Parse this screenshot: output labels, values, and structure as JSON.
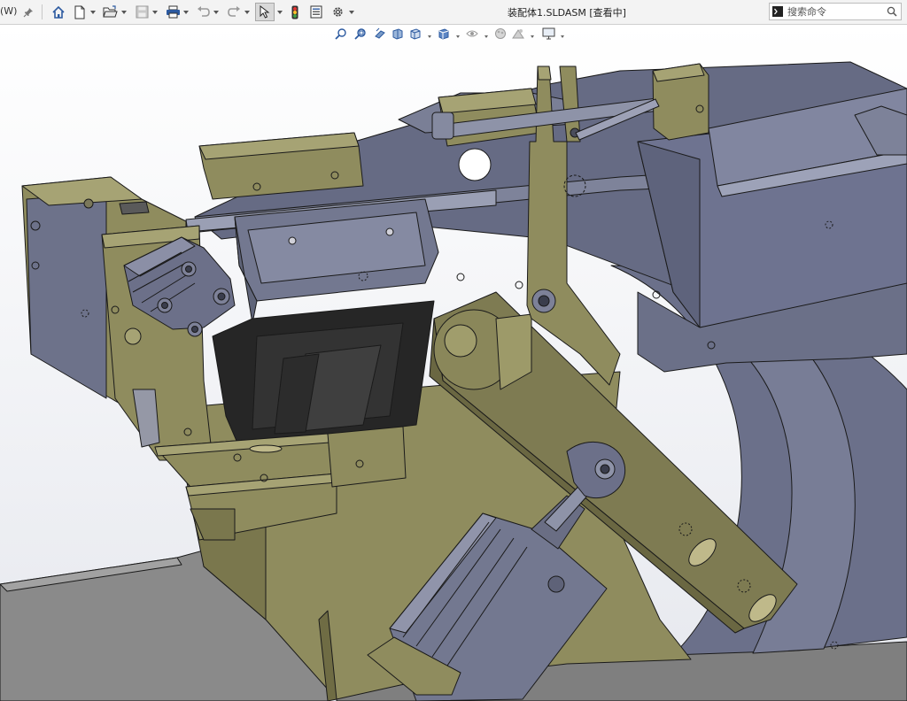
{
  "app": {
    "window_label_fragment": "(W)",
    "document_title": "装配体1.SLDASM [查看中]"
  },
  "toolbar": {
    "items": [
      {
        "name": "pin",
        "icon": "pin-icon"
      },
      {
        "name": "home",
        "icon": "home-icon"
      },
      {
        "name": "new",
        "icon": "new-document-icon"
      },
      {
        "name": "open",
        "icon": "open-folder-icon"
      },
      {
        "name": "save",
        "icon": "save-icon"
      },
      {
        "name": "print",
        "icon": "printer-icon"
      },
      {
        "name": "undo",
        "icon": "undo-icon"
      },
      {
        "name": "redo",
        "icon": "redo-icon"
      },
      {
        "name": "select",
        "icon": "cursor-arrow-icon"
      },
      {
        "name": "rebuild",
        "icon": "traffic-light-icon"
      },
      {
        "name": "file-properties",
        "icon": "file-properties-icon"
      },
      {
        "name": "options",
        "icon": "gear-icon"
      }
    ]
  },
  "search": {
    "placeholder": "搜索命令",
    "icon": "search-icon"
  },
  "heads_up_toolbar": {
    "items": [
      {
        "name": "zoom-to-fit",
        "icon": "zoom-fit-icon"
      },
      {
        "name": "zoom-to-area",
        "icon": "zoom-area-icon"
      },
      {
        "name": "previous-view",
        "icon": "previous-view-icon"
      },
      {
        "name": "section-view",
        "icon": "section-view-icon"
      },
      {
        "name": "view-orientation",
        "icon": "view-orientation-icon"
      },
      {
        "name": "display-style",
        "icon": "display-style-icon"
      },
      {
        "name": "hide-show-items",
        "icon": "hide-show-icon"
      },
      {
        "name": "edit-appearance",
        "icon": "appearance-icon"
      },
      {
        "name": "apply-scene",
        "icon": "scene-icon"
      },
      {
        "name": "view-settings",
        "icon": "monitor-icon"
      }
    ]
  },
  "colors": {
    "toolbar_bg": "#f3f3f3",
    "viewport_bg_top": "#ffffff",
    "viewport_bg_bottom": "#e6e8ee",
    "part_olive": "#8f8c5e",
    "part_olive_dark": "#757249",
    "part_bluegray": "#666b84",
    "part_bluegray_light": "#7d8299",
    "part_black": "#222222",
    "base_gray": "#8c8c8c",
    "edge": "#1a1a1a"
  }
}
